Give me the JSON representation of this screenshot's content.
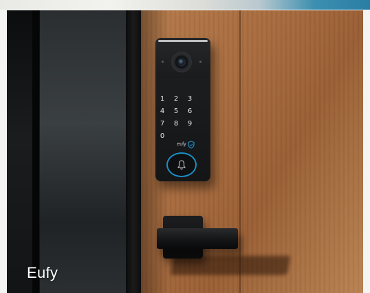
{
  "photo": {
    "caption": "Eufy",
    "device_brand": "eufy",
    "keypad_keys": [
      "1",
      "2",
      "3",
      "4",
      "5",
      "6",
      "7",
      "8",
      "9",
      "0"
    ],
    "icons": [
      "camera-icon",
      "shield-icon",
      "bell-icon"
    ],
    "colors": {
      "accent_ring": "#1c8fc8",
      "wood": "#a86c3f",
      "device_body": "#1a1b1c"
    }
  }
}
